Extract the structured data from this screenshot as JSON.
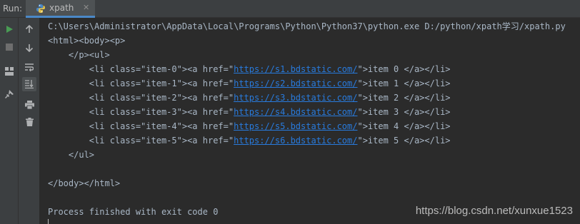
{
  "run_label": "Run:",
  "tab": {
    "title": "xpath",
    "close": "✕",
    "icon": "python-icon"
  },
  "toolbar_left": [
    "run-icon",
    "stop-icon",
    "layout-icon",
    "pin-icon"
  ],
  "toolbar_right": [
    "up-arrow-icon",
    "down-arrow-icon",
    "soft-wrap-icon",
    "scroll-to-end-icon",
    "print-icon",
    "trash-icon"
  ],
  "console": {
    "command": "C:\\Users\\Administrator\\AppData\\Local\\Programs\\Python\\Python37\\python.exe D:/python/xpath学习/xpath.py",
    "lines": [
      {
        "pre": "<html><body><p>",
        "url": "",
        "post": ""
      },
      {
        "pre": "    </p><ul>",
        "url": "",
        "post": ""
      },
      {
        "pre": "        <li class=\"item-0\"><a href=\"",
        "url": "https://s1.bdstatic.com/",
        "post": "\">item 0 </a></li>"
      },
      {
        "pre": "        <li class=\"item-1\"><a href=\"",
        "url": "https://s2.bdstatic.com/",
        "post": "\">item 1 </a></li>"
      },
      {
        "pre": "        <li class=\"item-2\"><a href=\"",
        "url": "https://s3.bdstatic.com/",
        "post": "\">item 2 </a></li>"
      },
      {
        "pre": "        <li class=\"item-3\"><a href=\"",
        "url": "https://s4.bdstatic.com/",
        "post": "\">item 3 </a></li>"
      },
      {
        "pre": "        <li class=\"item-4\"><a href=\"",
        "url": "https://s5.bdstatic.com/",
        "post": "\">item 4 </a></li>"
      },
      {
        "pre": "        <li class=\"item-5\"><a href=\"",
        "url": "https://s6.bdstatic.com/",
        "post": "\">item 5 </a></li>"
      },
      {
        "pre": "    </ul>",
        "url": "",
        "post": ""
      },
      {
        "pre": "",
        "url": "",
        "post": ""
      },
      {
        "pre": "</body></html>",
        "url": "",
        "post": ""
      },
      {
        "pre": "",
        "url": "",
        "post": ""
      },
      {
        "pre": "Process finished with exit code 0",
        "url": "",
        "post": ""
      }
    ]
  },
  "watermark": "https://blog.csdn.net/xunxue1523",
  "colors": {
    "text": "#a9b7c6",
    "link": "#287bde",
    "background": "#2b2b2b",
    "toolbar": "#3c3f41",
    "run_green": "#499c54"
  }
}
